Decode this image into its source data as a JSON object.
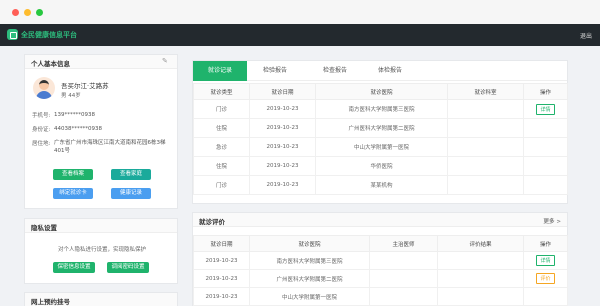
{
  "app": {
    "title": "全民健康信息平台",
    "logout": "退出"
  },
  "profile": {
    "section_title": "个人基本信息",
    "name": "吾买尔江·艾路苏",
    "gender_age": "男   44岁",
    "phone_label": "手机号:",
    "phone": "139******0938",
    "id_label": "身份证:",
    "id": "44038******0938",
    "addr_label": "居住地:",
    "addr": "广东省广州市海珠区江南大道南和花园6栋3梯401号",
    "buttons": {
      "archive": "查看档案",
      "family": "查看家庭",
      "bind_card": "绑定就诊卡",
      "health": "健康记录"
    }
  },
  "privacy": {
    "section_title": "隐私设置",
    "text": "对个人隐私进行设置，实现隐私保护",
    "btn_set": "保密信息设置",
    "btn_pwd": "调阅密码设置"
  },
  "appointment": {
    "section_title": "网上预约挂号"
  },
  "records": {
    "tabs": [
      "就诊记录",
      "检验报告",
      "检查报告",
      "体检报告"
    ],
    "headers": [
      "就诊类型",
      "就诊日期",
      "就诊医院",
      "就诊科室",
      "操作"
    ],
    "rows": [
      [
        "门诊",
        "2019-10-23",
        "南方医科大学附属第三医院",
        "",
        "详情"
      ],
      [
        "住院",
        "2019-10-23",
        "广州医科大学附属第二医院",
        "",
        ""
      ],
      [
        "急诊",
        "2019-10-23",
        "中山大学附属第一医院",
        "",
        ""
      ],
      [
        "住院",
        "2019-10-23",
        "华侨医院",
        "",
        ""
      ],
      [
        "门诊",
        "2019-10-23",
        "某某机构",
        "",
        ""
      ]
    ]
  },
  "evaluation": {
    "section_title": "就诊评价",
    "more": "更多 >",
    "headers": [
      "就诊日期",
      "就诊医院",
      "主治医师",
      "评价结果",
      "操作"
    ],
    "rows": [
      [
        "2019-10-23",
        "南方医科大学附属第三医院",
        "",
        "",
        "详情"
      ],
      [
        "2019-10-23",
        "广州医科大学附属第二医院",
        "",
        "",
        "评价"
      ],
      [
        "2019-10-23",
        "中山大学附属第一医院",
        "",
        "",
        ""
      ]
    ]
  },
  "colors": {
    "accent": "#1fb36c",
    "header": "#23292e",
    "warn": "#f5a623"
  }
}
